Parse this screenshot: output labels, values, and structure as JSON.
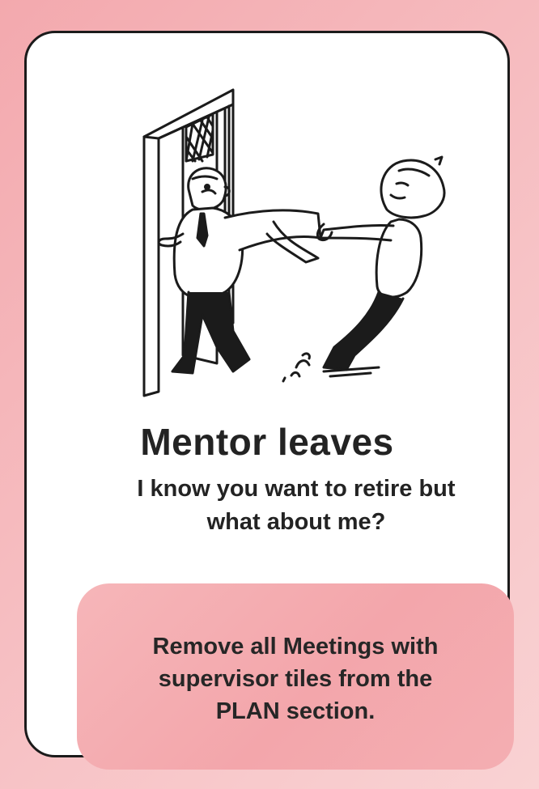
{
  "card": {
    "title": "Mentor leaves",
    "subtitle_line1": "I know you want to retire but",
    "subtitle_line2": "what about me?",
    "effect_line1": "Remove all Meetings with",
    "effect_line2": "supervisor tiles from the",
    "effect_line3": "PLAN section."
  },
  "colors": {
    "background": "#f5b5b9",
    "effect_box": "#f4aaaf",
    "ink": "#1b1b1b"
  },
  "illustration": {
    "icon": "mentor-leaving-student-pulling-sleeve-illustration"
  }
}
